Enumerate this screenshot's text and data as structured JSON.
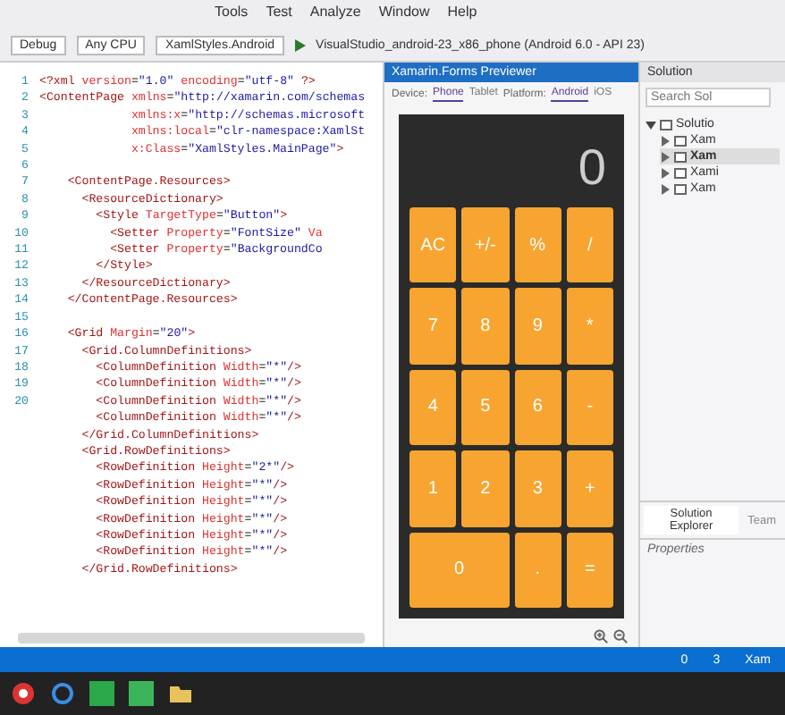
{
  "menu": [
    "Tools",
    "Test",
    "Analyze",
    "Window",
    "Help"
  ],
  "toolbar": {
    "config": "Debug",
    "platform": "Any CPU",
    "project": "XamlStyles.Android",
    "run_target": "VisualStudio_android-23_x86_phone (Android 6.0 - API 23)"
  },
  "editor": {
    "lines": [
      {
        "number": "1",
        "tokens": [
          {
            "kind": "tag",
            "text": "<?xml "
          },
          {
            "kind": "attr",
            "text": "version"
          },
          {
            "kind": "plain",
            "text": "="
          },
          {
            "kind": "value",
            "text": "\"1.0\""
          },
          {
            "kind": "attr",
            "text": " encoding"
          },
          {
            "kind": "plain",
            "text": "="
          },
          {
            "kind": "value",
            "text": "\"utf-8\""
          },
          {
            "kind": "tag",
            "text": " ?>"
          }
        ]
      },
      {
        "number": "2",
        "tokens": [
          {
            "kind": "tag",
            "text": "<ContentPage "
          },
          {
            "kind": "attr",
            "text": "xmlns"
          },
          {
            "kind": "plain",
            "text": "="
          },
          {
            "kind": "value",
            "text": "\"http://xamarin.com/schemas"
          }
        ]
      },
      {
        "number": "3",
        "tokens": [
          {
            "kind": "attr",
            "text": "             xmlns:x"
          },
          {
            "kind": "plain",
            "text": "="
          },
          {
            "kind": "value",
            "text": "\"http://schemas.microsoft"
          }
        ]
      },
      {
        "number": "4",
        "tokens": [
          {
            "kind": "attr",
            "text": "             xmlns:local"
          },
          {
            "kind": "plain",
            "text": "="
          },
          {
            "kind": "value",
            "text": "\"clr-namespace:XamlSt"
          }
        ]
      },
      {
        "number": "5",
        "tokens": [
          {
            "kind": "attr",
            "text": "             x:Class"
          },
          {
            "kind": "plain",
            "text": "="
          },
          {
            "kind": "value",
            "text": "\"XamlStyles.MainPage\""
          },
          {
            "kind": "tag",
            "text": ">"
          }
        ]
      },
      {
        "number": "6"
      },
      {
        "number": "7",
        "tokens": [
          {
            "kind": "tag",
            "text": "    <ContentPage.Resources>"
          }
        ]
      },
      {
        "number": "8",
        "tokens": [
          {
            "kind": "tag",
            "text": "      <ResourceDictionary>"
          }
        ]
      },
      {
        "number": "9",
        "tokens": [
          {
            "kind": "tag",
            "text": "        <Style "
          },
          {
            "kind": "attr",
            "text": "TargetType"
          },
          {
            "kind": "plain",
            "text": "="
          },
          {
            "kind": "value",
            "text": "\"Button\""
          },
          {
            "kind": "tag",
            "text": ">"
          }
        ]
      },
      {
        "number": "10",
        "tokens": [
          {
            "kind": "tag",
            "text": "          <Setter "
          },
          {
            "kind": "attr",
            "text": "Property"
          },
          {
            "kind": "plain",
            "text": "="
          },
          {
            "kind": "value",
            "text": "\"FontSize\""
          },
          {
            "kind": "attr",
            "text": " Va"
          }
        ]
      },
      {
        "number": "11",
        "tokens": [
          {
            "kind": "tag",
            "text": "          <Setter "
          },
          {
            "kind": "attr",
            "text": "Property"
          },
          {
            "kind": "plain",
            "text": "="
          },
          {
            "kind": "value",
            "text": "\"BackgroundCo"
          }
        ]
      },
      {
        "number": "12",
        "tokens": [
          {
            "kind": "tag",
            "text": "        </Style>"
          }
        ]
      },
      {
        "number": "13",
        "tokens": [
          {
            "kind": "tag",
            "text": "      </ResourceDictionary>"
          }
        ]
      },
      {
        "number": "14",
        "tokens": [
          {
            "kind": "tag",
            "text": "    </ContentPage.Resources>"
          }
        ]
      },
      {
        "number": "15"
      },
      {
        "number": "16",
        "tokens": [
          {
            "kind": "tag",
            "text": "    <Grid "
          },
          {
            "kind": "attr",
            "text": "Margin"
          },
          {
            "kind": "plain",
            "text": "="
          },
          {
            "kind": "value",
            "text": "\"20\""
          },
          {
            "kind": "tag",
            "text": ">"
          }
        ]
      },
      {
        "number": "17",
        "tokens": [
          {
            "kind": "tag",
            "text": "      <Grid.ColumnDefinitions>"
          }
        ]
      },
      {
        "number": "18",
        "tokens": [
          {
            "kind": "tag",
            "text": "        <ColumnDefinition "
          },
          {
            "kind": "attr",
            "text": "Width"
          },
          {
            "kind": "plain",
            "text": "="
          },
          {
            "kind": "value",
            "text": "\"*\""
          },
          {
            "kind": "tag",
            "text": "/>"
          }
        ]
      },
      {
        "number": "19",
        "tokens": [
          {
            "kind": "tag",
            "text": "        <ColumnDefinition "
          },
          {
            "kind": "attr",
            "text": "Width"
          },
          {
            "kind": "plain",
            "text": "="
          },
          {
            "kind": "value",
            "text": "\"*\""
          },
          {
            "kind": "tag",
            "text": "/>"
          }
        ]
      },
      {
        "number": "20",
        "tokens": [
          {
            "kind": "tag",
            "text": "        <ColumnDefinition "
          },
          {
            "kind": "attr",
            "text": "Width"
          },
          {
            "kind": "plain",
            "text": "="
          },
          {
            "kind": "value",
            "text": "\"*\""
          },
          {
            "kind": "tag",
            "text": "/>"
          }
        ]
      },
      {
        "tokens": [
          {
            "kind": "tag",
            "text": "        <ColumnDefinition "
          },
          {
            "kind": "attr",
            "text": "Width"
          },
          {
            "kind": "plain",
            "text": "="
          },
          {
            "kind": "value",
            "text": "\"*\""
          },
          {
            "kind": "tag",
            "text": "/>"
          }
        ]
      },
      {
        "tokens": [
          {
            "kind": "tag",
            "text": "      </Grid.ColumnDefinitions>"
          }
        ]
      },
      {
        "tokens": [
          {
            "kind": "tag",
            "text": "      <Grid.RowDefinitions>"
          }
        ]
      },
      {
        "tokens": [
          {
            "kind": "tag",
            "text": "        <RowDefinition "
          },
          {
            "kind": "attr",
            "text": "Height"
          },
          {
            "kind": "plain",
            "text": "="
          },
          {
            "kind": "value",
            "text": "\"2*\""
          },
          {
            "kind": "tag",
            "text": "/>"
          }
        ]
      },
      {
        "tokens": [
          {
            "kind": "tag",
            "text": "        <RowDefinition "
          },
          {
            "kind": "attr",
            "text": "Height"
          },
          {
            "kind": "plain",
            "text": "="
          },
          {
            "kind": "value",
            "text": "\"*\""
          },
          {
            "kind": "tag",
            "text": "/>"
          }
        ]
      },
      {
        "tokens": [
          {
            "kind": "tag",
            "text": "        <RowDefinition "
          },
          {
            "kind": "attr",
            "text": "Height"
          },
          {
            "kind": "plain",
            "text": "="
          },
          {
            "kind": "value",
            "text": "\"*\""
          },
          {
            "kind": "tag",
            "text": "/>"
          }
        ]
      },
      {
        "tokens": [
          {
            "kind": "tag",
            "text": "        <RowDefinition "
          },
          {
            "kind": "attr",
            "text": "Height"
          },
          {
            "kind": "plain",
            "text": "="
          },
          {
            "kind": "value",
            "text": "\"*\""
          },
          {
            "kind": "tag",
            "text": "/>"
          }
        ]
      },
      {
        "tokens": [
          {
            "kind": "tag",
            "text": "        <RowDefinition "
          },
          {
            "kind": "attr",
            "text": "Height"
          },
          {
            "kind": "plain",
            "text": "="
          },
          {
            "kind": "value",
            "text": "\"*\""
          },
          {
            "kind": "tag",
            "text": "/>"
          }
        ]
      },
      {
        "tokens": [
          {
            "kind": "tag",
            "text": "        <RowDefinition "
          },
          {
            "kind": "attr",
            "text": "Height"
          },
          {
            "kind": "plain",
            "text": "="
          },
          {
            "kind": "value",
            "text": "\"*\""
          },
          {
            "kind": "tag",
            "text": "/>"
          }
        ]
      },
      {
        "tokens": [
          {
            "kind": "tag",
            "text": "      </Grid.RowDefinitions>"
          }
        ]
      }
    ]
  },
  "previewer": {
    "title": "Xamarin.Forms Previewer",
    "devices": [
      {
        "label": "Phone",
        "selected": true
      },
      {
        "label": "Tablet",
        "selected": false
      }
    ],
    "device_label": "Device:",
    "platform_label": "Platform:",
    "platforms": [
      {
        "label": "Android",
        "selected": true
      },
      {
        "label": "iOS",
        "selected": false
      }
    ],
    "display": "0",
    "keys": [
      {
        "label": "AC",
        "kind": "normal"
      },
      {
        "label": "+/-",
        "kind": "normal"
      },
      {
        "label": "%",
        "kind": "normal"
      },
      {
        "label": "/",
        "kind": "normal"
      },
      {
        "label": "7",
        "kind": "normal"
      },
      {
        "label": "8",
        "kind": "normal"
      },
      {
        "label": "9",
        "kind": "normal"
      },
      {
        "label": "*",
        "kind": "normal"
      },
      {
        "label": "4",
        "kind": "normal"
      },
      {
        "label": "5",
        "kind": "normal"
      },
      {
        "label": "6",
        "kind": "normal"
      },
      {
        "label": "-",
        "kind": "normal"
      },
      {
        "label": "1",
        "kind": "normal"
      },
      {
        "label": "2",
        "kind": "normal"
      },
      {
        "label": "3",
        "kind": "normal"
      },
      {
        "label": "+",
        "kind": "normal"
      },
      {
        "label": "0",
        "kind": "wide"
      },
      {
        "label": ".",
        "kind": "normal"
      },
      {
        "label": "=",
        "kind": "normal"
      }
    ]
  },
  "solution_explorer": {
    "title": "Solution",
    "search": {
      "placeholder": "Search Sol"
    },
    "items": [
      {
        "label": "Solutio",
        "expanded": true,
        "children": [
          {
            "label": "Xam",
            "expanded": false,
            "selected": false
          },
          {
            "label": "Xam",
            "expanded": false,
            "selected": true
          },
          {
            "label": "Xami",
            "expanded": false,
            "selected": false
          },
          {
            "label": "Xam",
            "expanded": false,
            "selected": false
          }
        ]
      }
    ],
    "tabs": [
      {
        "label": "Solution Explorer",
        "selected": true
      },
      {
        "label": "Team",
        "selected": false
      }
    ]
  },
  "properties": {
    "title": "Properties"
  },
  "status_bar": {
    "items": [
      "0",
      "3",
      "Xam"
    ]
  }
}
